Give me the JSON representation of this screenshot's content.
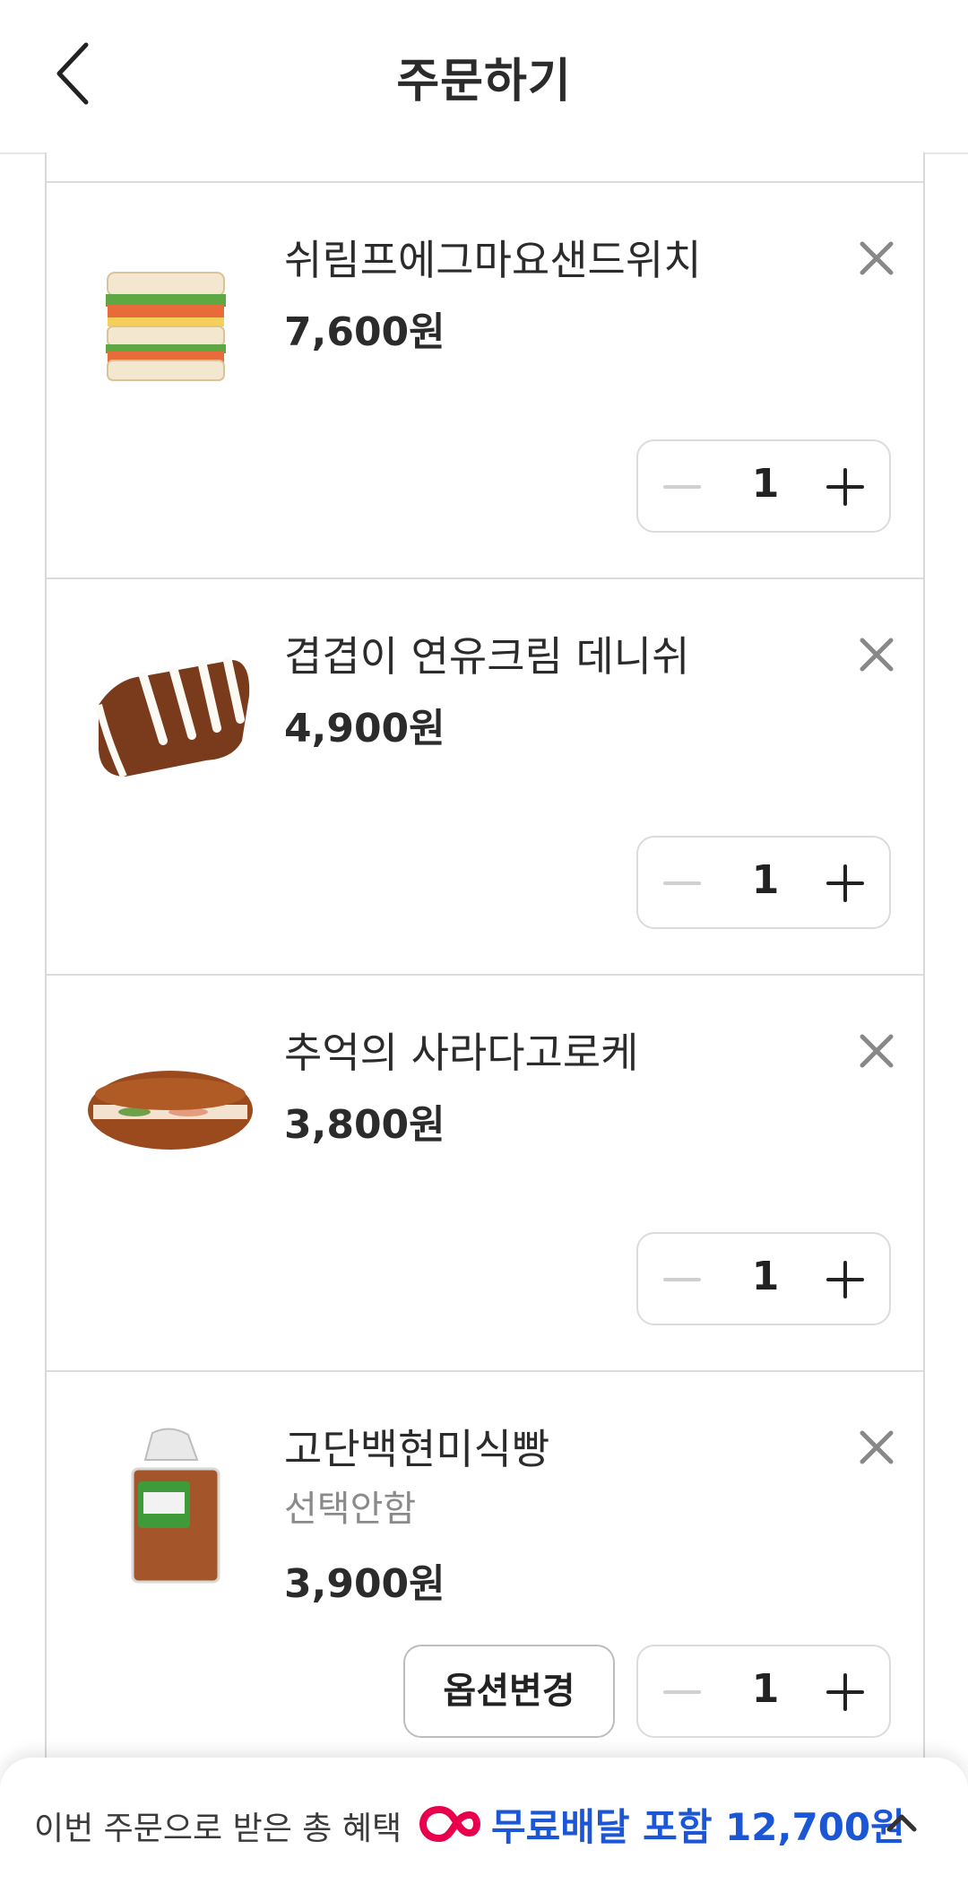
{
  "header": {
    "title": "주문하기"
  },
  "items": [
    {
      "name": "쉬림프에그마요샌드위치",
      "option": "",
      "price": "7,600원",
      "qty": "1",
      "image": "sandwich-image"
    },
    {
      "name": "겹겹이 연유크림 데니쉬",
      "option": "",
      "price": "4,900원",
      "qty": "1",
      "image": "danish-bread-image"
    },
    {
      "name": "추억의 사라다고로케",
      "option": "",
      "price": "3,800원",
      "qty": "1",
      "image": "croquette-image"
    },
    {
      "name": "고단백현미식빵",
      "option": "선택안함",
      "price": "3,900원",
      "qty": "1",
      "image": "bread-loaf-image",
      "option_button": "옵션변경"
    }
  ],
  "footer": {
    "benefit_label": "이번 주문으로 받은 총 혜택",
    "benefit_value": "무료배달 포함 12,700원",
    "logo_icon": "point-logo-icon",
    "expand_icon": "chevron-up-icon"
  },
  "colors": {
    "accent": "#1a56d6",
    "logo": "#e8004c"
  }
}
